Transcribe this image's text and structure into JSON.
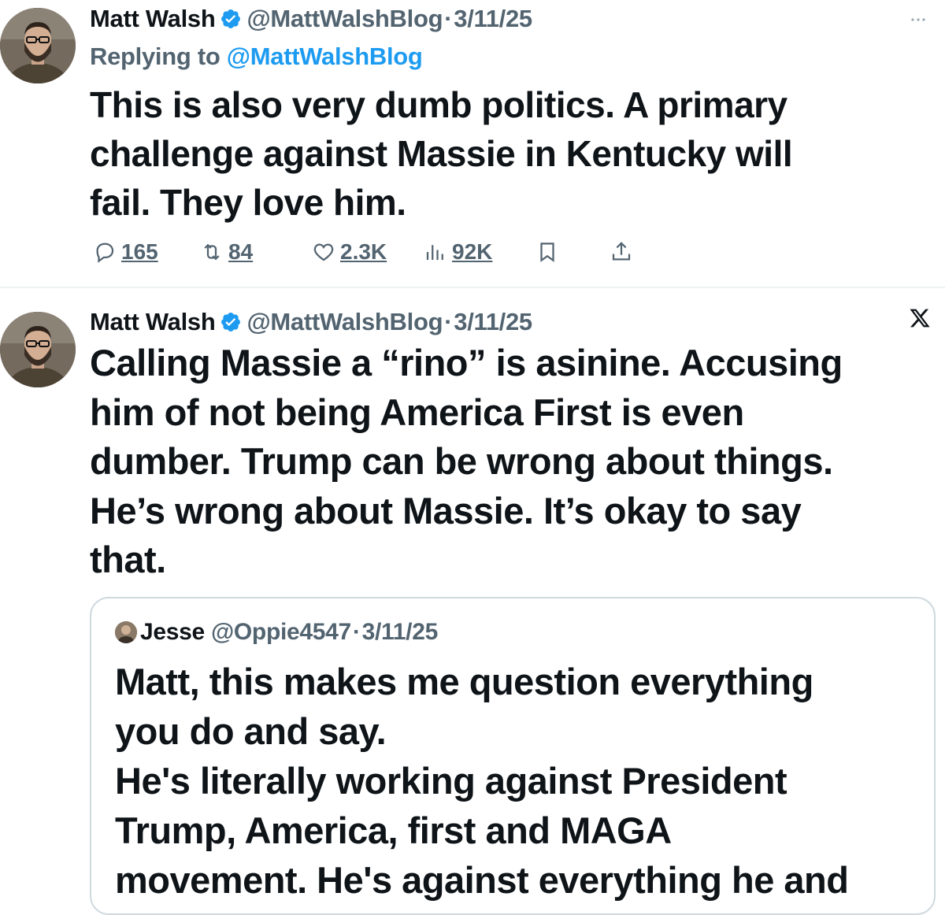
{
  "tweets": [
    {
      "author_name": "Matt Walsh",
      "handle": "@MattWalshBlog",
      "date": "3/11/25",
      "replying_prefix": "Replying to ",
      "replying_to": "@MattWalshBlog",
      "text": "This is also very dumb politics. A primary\nchallenge against Massie in Kentucky will\nfail. They love him.",
      "stats": {
        "replies": "165",
        "reposts": "84",
        "likes": "2.3K",
        "views": "92K"
      }
    },
    {
      "author_name": "Matt Walsh",
      "handle": "@MattWalshBlog",
      "date": "3/11/25",
      "text": "Calling Massie a “rino” is asinine. Accusing\nhim of not being America First is even\ndumber. Trump can be wrong about things.\nHe’s wrong about Massie. It’s okay to say\nthat.",
      "quote": {
        "author_name": "Jesse",
        "handle": "@Oppie4547",
        "date": "3/11/25",
        "text": "Matt, this makes me question everything\nyou do and say.\nHe's literally working against President\nTrump, America, first and MAGA\nmovement. He's against everything he and"
      }
    }
  ],
  "separator": "·",
  "icons": {
    "verified": "verified-badge-icon",
    "more": "more-icon",
    "x_logo": "x-logo-icon",
    "reply": "reply-icon",
    "repost": "repost-icon",
    "like": "like-icon",
    "views": "views-icon",
    "bookmark": "bookmark-icon",
    "share": "share-icon"
  },
  "colors": {
    "text": "#0f1419",
    "secondary": "#536471",
    "accent": "#1d9bf0",
    "border": "#cfd9de"
  }
}
